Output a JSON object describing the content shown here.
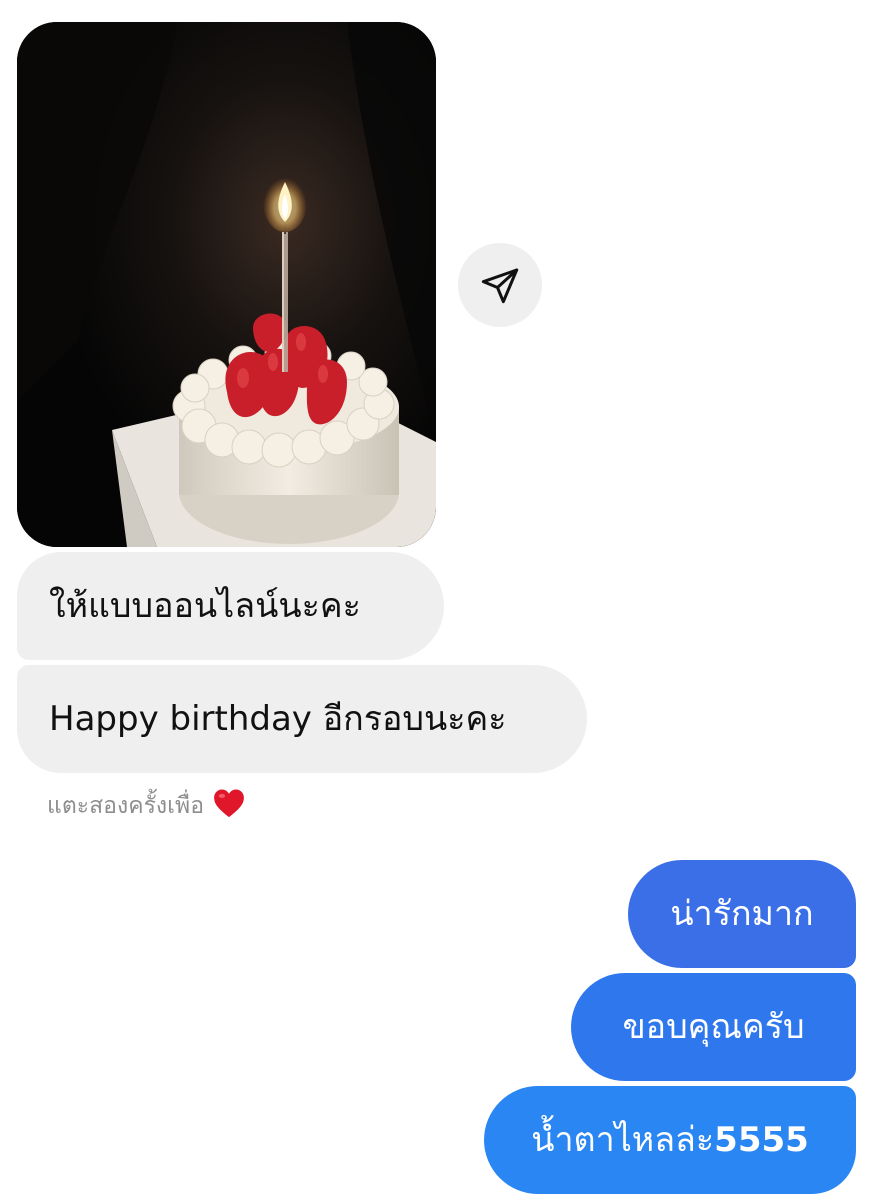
{
  "conversation": {
    "incoming": {
      "photo_alt": "",
      "messages": [
        {
          "text": "ให้แบบออนไลน์นะคะ"
        },
        {
          "text": "Happy birthday อีกรอบนะคะ"
        }
      ],
      "reaction_hint": "แตะสองครั้งเพื่อ",
      "reaction_emoji": "❤️"
    },
    "outgoing": {
      "messages": [
        {
          "text": "น่ารักมาก"
        },
        {
          "text": "ขอบคุณครับ"
        },
        {
          "text_prefix": "น้ำตาไหลล่ะ",
          "text_number": "5555"
        }
      ]
    }
  },
  "icons": {
    "share": "paper-plane-icon",
    "reaction": "heart-icon"
  },
  "colors": {
    "incoming_bubble": "#efefef",
    "outgoing_bubble": "#2d7bf0",
    "hint_text": "#8e8e8e",
    "heart": "#e0162b"
  }
}
